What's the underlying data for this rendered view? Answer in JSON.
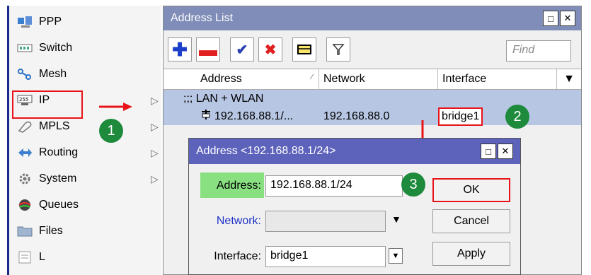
{
  "sidebar": {
    "items": [
      {
        "label": "PPP",
        "icon": "ppp-icon",
        "arrow": false
      },
      {
        "label": "Switch",
        "icon": "switch-icon",
        "arrow": false
      },
      {
        "label": "Mesh",
        "icon": "mesh-icon",
        "arrow": false
      },
      {
        "label": "IP",
        "icon": "ip-icon",
        "arrow": true
      },
      {
        "label": "MPLS",
        "icon": "mpls-icon",
        "arrow": true
      },
      {
        "label": "Routing",
        "icon": "routing-icon",
        "arrow": true
      },
      {
        "label": "System",
        "icon": "system-icon",
        "arrow": true
      },
      {
        "label": "Queues",
        "icon": "queues-icon",
        "arrow": false
      },
      {
        "label": "Files",
        "icon": "files-icon",
        "arrow": false
      },
      {
        "label": "L",
        "icon": "log-icon",
        "arrow": false
      }
    ]
  },
  "badges": {
    "one": "1",
    "two": "2",
    "three": "3"
  },
  "address_list": {
    "title": "Address List",
    "find_placeholder": "Find",
    "columns": [
      "Address",
      "Network",
      "Interface"
    ],
    "group_label": ";;; LAN + WLAN",
    "rows": [
      {
        "address": "192.168.88.1/...",
        "network": "192.168.88.0",
        "interface": "bridge1"
      }
    ]
  },
  "dialog": {
    "title": "Address <192.168.88.1/24>",
    "address_label": "Address:",
    "address_value": "192.168.88.1/24",
    "network_label": "Network:",
    "network_value": "",
    "interface_label": "Interface:",
    "interface_value": "bridge1",
    "ok_label": "OK",
    "cancel_label": "Cancel",
    "apply_label": "Apply"
  },
  "colors": {
    "highlight_red": "#e8141a",
    "badge_green": "#1d8a3c",
    "title_bar": "#7f8db8",
    "dialog_title": "#5d62ba",
    "selection": "#b7c6e3"
  }
}
